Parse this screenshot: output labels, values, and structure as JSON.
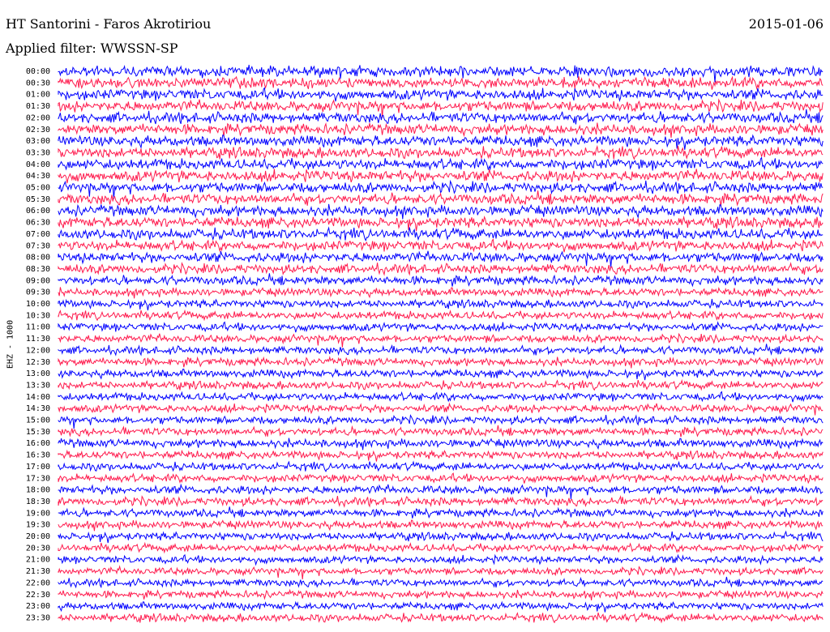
{
  "header": {
    "title": "HT Santorini - Faros Akrotiriou",
    "date": "2015-01-06",
    "filter": "Applied filter: WWSSN-SP"
  },
  "axis": {
    "ylabel": "EHZ - 1000"
  },
  "colors": {
    "trace_a": "#0000ff",
    "trace_b": "#ff1a4d",
    "background": "#ffffff",
    "text": "#000000"
  },
  "chart_data": {
    "type": "line",
    "title": "HT Santorini - Faros Akrotiriou",
    "subtitle": "Applied filter: WWSSN-SP",
    "ylabel": "EHZ - 1000",
    "xlabel": "",
    "grid": false,
    "legend": "none",
    "series_colors": [
      "#0000ff",
      "#ff1a4d"
    ],
    "categories": [
      "00:00",
      "00:30",
      "01:00",
      "01:30",
      "02:00",
      "02:30",
      "03:00",
      "03:30",
      "04:00",
      "04:30",
      "05:00",
      "05:30",
      "06:00",
      "06:30",
      "07:00",
      "07:30",
      "08:00",
      "08:30",
      "09:00",
      "09:30",
      "10:00",
      "10:30",
      "11:00",
      "11:30",
      "12:00",
      "12:30",
      "13:00",
      "13:30",
      "14:00",
      "14:30",
      "15:00",
      "15:30",
      "16:00",
      "16:30",
      "17:00",
      "17:30",
      "18:00",
      "18:30",
      "19:00",
      "19:30",
      "20:00",
      "20:30",
      "21:00",
      "21:30",
      "22:00",
      "22:30",
      "23:00",
      "23:30"
    ],
    "relative_amplitude": [
      1.0,
      1.0,
      1.0,
      1.0,
      1.0,
      1.0,
      1.0,
      1.0,
      1.0,
      1.05,
      1.0,
      1.0,
      1.0,
      1.0,
      1.0,
      0.95,
      0.95,
      0.9,
      0.85,
      0.75,
      0.75,
      0.75,
      0.75,
      0.75,
      0.75,
      0.75,
      0.75,
      0.75,
      0.75,
      0.75,
      0.75,
      0.75,
      0.8,
      0.75,
      0.75,
      0.75,
      0.8,
      0.8,
      0.75,
      0.75,
      0.75,
      0.75,
      0.7,
      0.7,
      0.7,
      0.7,
      0.7,
      0.75
    ]
  }
}
